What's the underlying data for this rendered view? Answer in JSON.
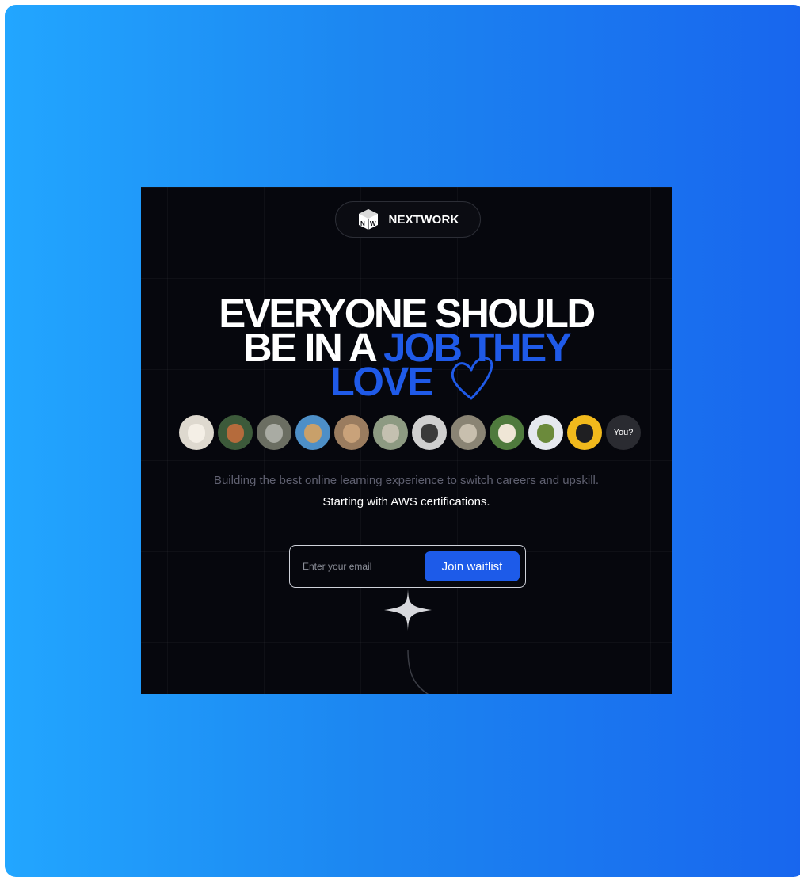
{
  "brand": {
    "name": "NEXTWORK",
    "logo_icon": "nextwork-cube-logo",
    "logo_lettering": "NW"
  },
  "hero": {
    "line1": "EVERYONE SHOULD",
    "line2_white": "BE IN A ",
    "line2_blue": "JOB THEY",
    "line3_blue": "LOVE",
    "heart_icon": "heart-outline-icon",
    "accent_color": "#1f5ae8"
  },
  "avatars": {
    "items": [
      {
        "name": "pekingese-dog-avatar",
        "bg": "#ded9cf",
        "face": "#f4efe6"
      },
      {
        "name": "squirrel-avatar",
        "bg": "#3c5a3a",
        "face": "#b56b3c"
      },
      {
        "name": "koala-avatar",
        "bg": "#6b6e62",
        "face": "#a9aba3"
      },
      {
        "name": "giraffe-avatar",
        "bg": "#4d8fc7",
        "face": "#c8a06a"
      },
      {
        "name": "cat-avatar",
        "bg": "#9a7c5f",
        "face": "#c9a27a"
      },
      {
        "name": "owl-statue-avatar",
        "bg": "#8d9a82",
        "face": "#c4c0b0"
      },
      {
        "name": "pug-avatar",
        "bg": "#cfcfcf",
        "face": "#3a3a3a"
      },
      {
        "name": "seal-avatar",
        "bg": "#8a8474",
        "face": "#c8bfae"
      },
      {
        "name": "alpaca-avatar",
        "bg": "#4f7a3d",
        "face": "#efe6d6"
      },
      {
        "name": "pineapple-avatar",
        "bg": "#e5e8ee",
        "face": "#6b8a3b"
      },
      {
        "name": "black-pug-avatar",
        "bg": "#f1b91c",
        "face": "#1f1f22"
      }
    ],
    "you_label": "You?"
  },
  "subtitle": {
    "line1": "Building the best online learning experience to switch careers and upskill.",
    "line2": "Starting with AWS certifications."
  },
  "waitlist": {
    "email_placeholder": "Enter your email",
    "email_value": "",
    "button_label": "Join waitlist"
  },
  "decor": {
    "sparkle_icon": "sparkle-star-icon"
  },
  "colors": {
    "background_gradient_start": "#22a6ff",
    "background_gradient_end": "#1866ee",
    "card_background": "#06070d",
    "button": "#1d5be9"
  }
}
